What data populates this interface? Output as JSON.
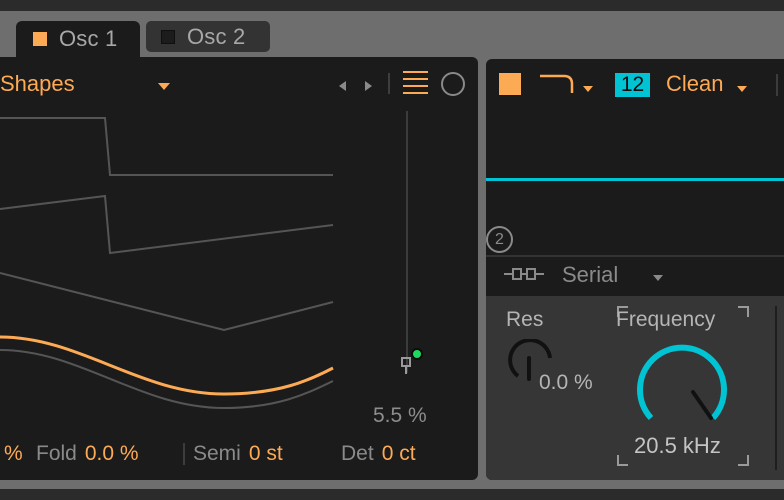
{
  "tabs": [
    {
      "label": "Osc 1",
      "active": true,
      "color": "#fdaa55"
    },
    {
      "label": "Osc 2",
      "active": false,
      "color": "#1c1c1c"
    }
  ],
  "oscillator": {
    "shape_selector": {
      "label": "Shapes",
      "icon": "dropdown-arrow-icon"
    },
    "nav": {
      "prev_icon": "triangle-left-icon",
      "next_icon": "triangle-right-icon"
    },
    "view_icons": [
      "list-icon",
      "circle-icon"
    ],
    "wave_preview": {
      "waveforms": [
        "square",
        "saw",
        "triangle",
        "sine-selected",
        "sine-shadow"
      ],
      "selected_color": "#fdaa55"
    },
    "slider": {
      "value_label": "5.5 %",
      "value_percent": 5.5,
      "mod_indicator_color": "#1ed760"
    },
    "params": [
      {
        "key": "",
        "value": "%"
      },
      {
        "key": "Fold",
        "value": "0.0 %"
      },
      {
        "key": "Semi",
        "value": "0 st"
      },
      {
        "key": "Det",
        "value": "0 ct"
      }
    ]
  },
  "filter": {
    "enabled": true,
    "type_icon": "lowpass-curve-icon",
    "slope": "12",
    "mode": "Clean",
    "badge": "2",
    "routing": {
      "label": "Serial",
      "icon": "serial-routing-icon"
    },
    "res": {
      "label": "Res",
      "value": "0.0 %",
      "fraction": 0.0
    },
    "frequency": {
      "label": "Frequency",
      "value": "20.5 kHz",
      "fraction": 0.99
    },
    "accent_color": "#00c4d4"
  }
}
